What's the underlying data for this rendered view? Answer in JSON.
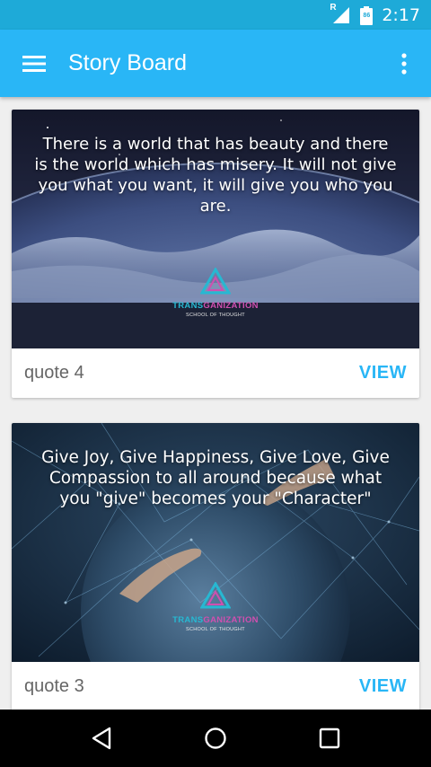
{
  "status_bar": {
    "time": "2:17",
    "signal_label": "R",
    "battery_label": "86",
    "icons": [
      "signal-icon",
      "battery-icon"
    ]
  },
  "app_bar": {
    "title": "Story Board",
    "menu_icon": "hamburger-menu-icon",
    "overflow_icon": "more-vert-icon",
    "background": "#29b6f6"
  },
  "cards": [
    {
      "quote": "There is a world that has beauty and there is the world which has misery. It will not give you what you want, it will give you who you are.",
      "logo_name_1": "TRANS",
      "logo_name_2": "GANIZATION",
      "logo_sub": "SCHOOL OF THOUGHT",
      "label": "quote 4",
      "action": "VIEW"
    },
    {
      "quote": "Give Joy, Give Happiness, Give Love, Give Compassion to all around because what you \"give\" becomes your \"Character\"",
      "logo_name_1": "TRANS",
      "logo_name_2": "GANIZATION",
      "logo_sub": "SCHOOL OF THOUGHT",
      "label": "quote 3",
      "action": "VIEW"
    }
  ],
  "nav_bar": {
    "icons": [
      "back-icon",
      "home-icon",
      "recents-icon"
    ]
  },
  "colors": {
    "accent": "#29b6f6",
    "status_bar": "#1eaad8",
    "logo_cyan": "#27b8d2",
    "logo_magenta": "#d04fb0"
  }
}
